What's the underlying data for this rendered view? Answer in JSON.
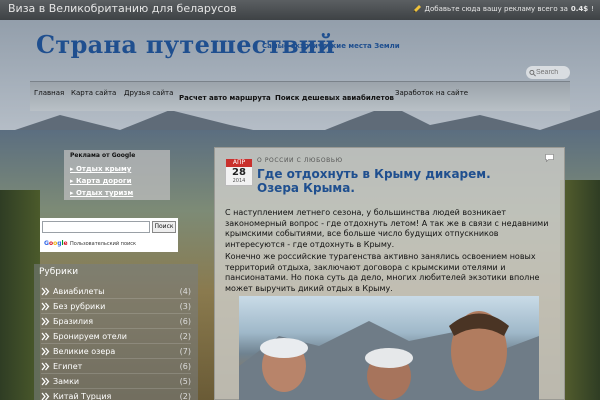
{
  "topbar": {
    "title": "Виза в Великобританию для беларусов",
    "ad_text": "Добавьте сюда вашу рекламу всего за",
    "ad_price": "0.4$",
    "ad_suffix": "!"
  },
  "header": {
    "site_title": "Страна путешествий",
    "tagline": "Самые экзотические места Земли"
  },
  "search": {
    "placeholder": "Search"
  },
  "nav": {
    "items": [
      "Главная",
      "Карта сайта",
      "Друзья сайта",
      "Расчет авто маршрута",
      "Поиск дешевых авиабилетов",
      "Заработок на сайте"
    ]
  },
  "ad_widget": {
    "heading": "Реклама от Google",
    "links": [
      "Отдых крыму",
      "Карта дороги",
      "Отдых туризм"
    ]
  },
  "google_search": {
    "button": "Поиск",
    "logo": "Google",
    "subtitle": "Пользовательский поиск"
  },
  "rubrics": {
    "title": "Рубрики",
    "items": [
      {
        "name": "Авиабилеты",
        "count": "(4)"
      },
      {
        "name": "Без рубрики",
        "count": "(3)"
      },
      {
        "name": "Бразилия",
        "count": "(6)"
      },
      {
        "name": "Бронируем отели",
        "count": "(2)"
      },
      {
        "name": "Великие озера",
        "count": "(7)"
      },
      {
        "name": "Египет",
        "count": "(6)"
      },
      {
        "name": "Замки",
        "count": "(5)"
      },
      {
        "name": "Китай Турция",
        "count": "(2)"
      }
    ]
  },
  "article": {
    "date_month": "АПР",
    "date_day": "28",
    "date_year": "2014",
    "category": "О РОССИИ С ЛЮБОВЬЮ",
    "title": "Где отдохнуть в Крыму дикарем. Озера Крыма.",
    "paragraphs": [
      "С наступлением летнего сезона, у большинства людей возникает закономерный вопрос - где отдохнуть летом! А так же в связи с недавними крымскими событиями, все больше число будущих отпускников интересуются - где отдохнуть в Крыму.",
      "Конечно же российские турагенства активно занялись освоением новых территорий отдыха, заключают договора с крымскими отелями и пансионатами. Но пока суть да дело, многих любителей экзотики вполне может выручить дикий отдых в Крыму."
    ]
  },
  "colors": {
    "accent": "#1f4f8f",
    "date_red": "#c9302c"
  }
}
